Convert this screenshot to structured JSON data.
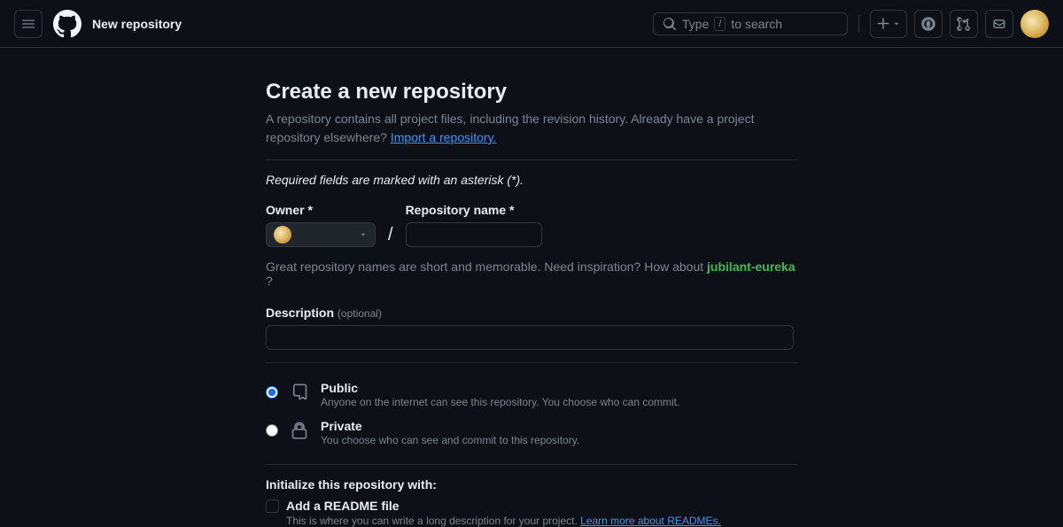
{
  "header": {
    "title": "New repository",
    "search_placeholder_prefix": "Type",
    "search_key": "/",
    "search_placeholder_suffix": "to search"
  },
  "main": {
    "heading": "Create a new repository",
    "subhead_1": "A repository contains all project files, including the revision history. Already have a project repository elsewhere? ",
    "import_link": "Import a repository.",
    "required_note": "Required fields are marked with an asterisk (*).",
    "owner_label": "Owner *",
    "repo_name_label": "Repository name *",
    "repo_name_value": "",
    "hint_text": "Great repository names are short and memorable. Need inspiration? How about ",
    "suggestion": "jubilant-eureka",
    "hint_q": " ?",
    "description_label": "Description",
    "description_optional": "(optional)",
    "description_value": "",
    "visibility": {
      "public": {
        "title": "Public",
        "desc": "Anyone on the internet can see this repository. You choose who can commit."
      },
      "private": {
        "title": "Private",
        "desc": "You choose who can see and commit to this repository."
      }
    },
    "init_heading": "Initialize this repository with:",
    "readme_title": "Add a README file",
    "readme_desc": "This is where you can write a long description for your project. ",
    "readme_link": "Learn more about READMEs."
  }
}
